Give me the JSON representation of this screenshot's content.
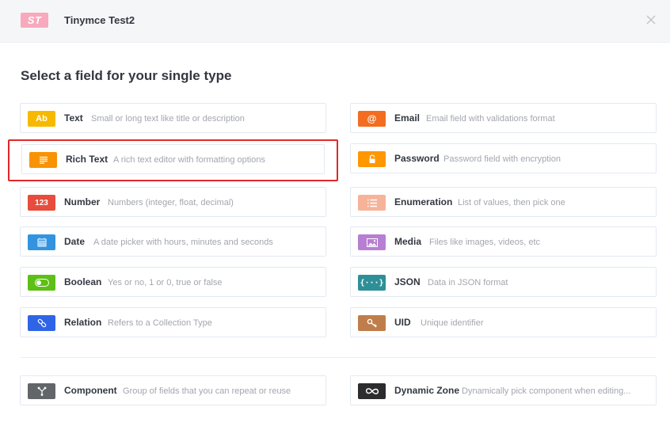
{
  "header": {
    "badge": "ST",
    "title": "Tinymce Test2"
  },
  "heading": "Select a field for your single type",
  "fields": {
    "text": {
      "icon_label": "Ab",
      "name": "Text",
      "description": "Small or long text like title or description",
      "icon": "text-icon",
      "color": "#f7b900"
    },
    "email": {
      "icon_label": "@",
      "name": "Email",
      "description": "Email field with validations format",
      "icon": "at-icon",
      "color": "#f36d20"
    },
    "rich_text": {
      "name": "Rich Text",
      "description": "A rich text editor with formatting options",
      "icon": "paragraph-lines-icon",
      "color": "#f79304"
    },
    "password": {
      "name": "Password",
      "description": "Password field with encryption",
      "icon": "lock-icon",
      "color": "#ff9700"
    },
    "number": {
      "icon_label": "123",
      "name": "Number",
      "description": "Numbers (integer, float, decimal)",
      "icon": "number-icon",
      "color": "#e74c3c"
    },
    "enumeration": {
      "name": "Enumeration",
      "description": "List of values, then pick one",
      "icon": "list-icon",
      "color": "#f6b39a"
    },
    "date": {
      "name": "Date",
      "description": "A date picker with hours, minutes and seconds",
      "icon": "calendar-icon",
      "color": "#3293e0"
    },
    "media": {
      "name": "Media",
      "description": "Files like images, videos, etc",
      "icon": "image-icon",
      "color": "#b77ed2"
    },
    "boolean": {
      "name": "Boolean",
      "description": "Yes or no, 1 or 0, true or false",
      "icon": "toggle-icon",
      "color": "#5ebf17"
    },
    "json": {
      "icon_label": "{···}",
      "name": "JSON",
      "description": "Data in JSON format",
      "icon": "braces-icon",
      "color": "#2e8f97"
    },
    "relation": {
      "name": "Relation",
      "description": "Refers to a Collection Type",
      "icon": "link-icon",
      "color": "#2f64e6"
    },
    "uid": {
      "name": "UID",
      "description": "Unique identifier",
      "icon": "key-icon",
      "color": "#bf7d4c"
    },
    "component": {
      "name": "Component",
      "description": "Group of fields that you can repeat or reuse",
      "icon": "component-icon",
      "color": "#626669"
    },
    "dynamic_zone": {
      "name": "Dynamic Zone",
      "description": "Dynamically pick component when editing...",
      "icon": "infinity-icon",
      "color": "#2c2c2f"
    }
  }
}
